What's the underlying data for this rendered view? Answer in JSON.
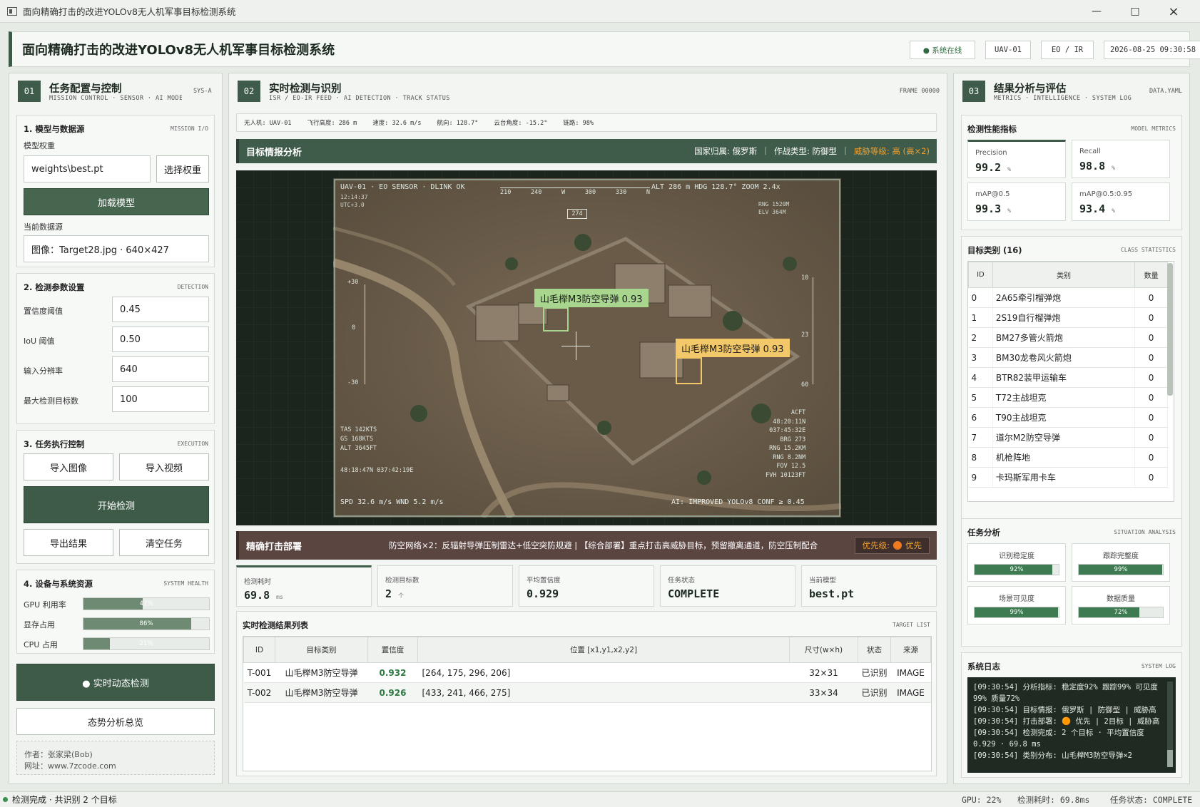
{
  "window": {
    "title": "面向精确打击的改进YOLOv8无人机军事目标检测系统",
    "minimize_icon": "minimize-icon",
    "maximize_icon": "maximize-icon",
    "close_icon": "close-icon"
  },
  "header": {
    "title": "面向精确打击的改进YOLOv8无人机军事目标检测系统",
    "chips": [
      "● 系统在线",
      "UAV-01",
      "EO / IR",
      "2026-08-25 09:30:58"
    ]
  },
  "left": {
    "num": "01",
    "title": "任务配置与控制",
    "subtitle": "MISSION CONTROL · SENSOR · AI MODEL",
    "tag": "SYS-A",
    "model": {
      "title": "1. 模型与数据源",
      "tag": "MISSION I/O",
      "weight_label": "模型权重",
      "weight_value": "weights\\best.pt",
      "choose_weight": "选择权重",
      "load_model": "加载模型",
      "source_label": "当前数据源",
      "source_value": "图像：Target28.jpg · 640×427"
    },
    "params": {
      "title": "2. 检测参数设置",
      "tag": "DETECTION",
      "items": [
        {
          "label": "置信度阈值",
          "value": "0.45"
        },
        {
          "label": "IoU 阈值",
          "value": "0.50"
        },
        {
          "label": "输入分辨率",
          "value": "640"
        },
        {
          "label": "最大检测目标数",
          "value": "100"
        }
      ]
    },
    "exec": {
      "title": "3. 任务执行控制",
      "tag": "EXECUTION",
      "import_image": "导入图像",
      "import_video": "导入视频",
      "start": "开始检测",
      "export": "导出结果",
      "clear": "清空任务"
    },
    "health": {
      "title": "4. 设备与系统资源",
      "tag": "SYSTEM HEALTH",
      "items": [
        {
          "label": "GPU 利用率",
          "value": 47,
          "text": "47%"
        },
        {
          "label": "显存占用",
          "value": 86,
          "text": "86%"
        },
        {
          "label": "CPU 占用",
          "value": 21,
          "text": "21%"
        }
      ]
    },
    "realtime_btn": "● 实时动态检测",
    "overview_btn": "态势分析总览",
    "author": "作者：张家梁(Bob)",
    "site": "网址：www.7zcode.com"
  },
  "center": {
    "num": "02",
    "title": "实时检测与识别",
    "subtitle": "ISR / EO-IR FEED · AI DETECTION · TRACK STATUS",
    "tag": "FRAME 00000",
    "telemetry": [
      "无人机: UAV-01",
      "飞行高度: 286 m",
      "速度: 32.6 m/s",
      "航向: 128.7°",
      "云台角度: -15.2°",
      "链路: 98%"
    ],
    "intel": {
      "title": "目标情报分析",
      "country": "国家归属: 俄罗斯",
      "type": "作战类型: 防御型",
      "threat": "威胁等级: 高 (高×2)"
    },
    "hud": {
      "top_left": "UAV-01 · EO SENSOR · DLINK OK",
      "top_right": "ALT 286 m   HDG 128.7°   ZOOM 2.4x",
      "time": "12:14:37",
      "utc": "UTC+3.0",
      "heading_box": "274",
      "compass": [
        "210",
        "240",
        "W",
        "300",
        "330",
        "N"
      ],
      "rng_elv": [
        "RNG  1520M",
        "ELV   364M"
      ],
      "left_scale": [
        "+30",
        "0",
        "-30"
      ],
      "right_scale": [
        "10",
        "23",
        "60"
      ],
      "left_block": [
        "TAS  142KTS",
        "GS   168KTS",
        "ALT   3645FT"
      ],
      "coords": "48:18:47N  037:42:19E",
      "right_block": [
        "ACFT",
        "48:20:11N",
        "037:45:32E",
        "BRG     273",
        "RNG  15.2KM",
        "RNG   8.2NM",
        "FOV    12.5",
        "FVH  10123FT"
      ],
      "bottom_left": "SPD 32.6 m/s   WND 5.2 m/s",
      "bottom_right": "AI: IMPROVED YOLOv8   CONF ≥ 0.45"
    },
    "detections": [
      {
        "label": "山毛榉M3防空导弹  0.93"
      },
      {
        "label": "山毛榉M3防空导弹  0.93"
      }
    ],
    "strike": {
      "title": "精确打击部署",
      "text": "防空网络×2：反辐射导弹压制雷达+低空突防规避 | 【综合部署】重点打击高威胁目标，预留撤离通道，防空压制配合",
      "priority_label": "优先级:",
      "priority_value": "优先"
    },
    "stats": [
      {
        "label": "检测耗时",
        "value": "69.8",
        "unit": "ms"
      },
      {
        "label": "检测目标数",
        "value": "2",
        "unit": "个"
      },
      {
        "label": "平均置信度",
        "value": "0.929",
        "unit": ""
      },
      {
        "label": "任务状态",
        "value": "COMPLETE",
        "unit": ""
      },
      {
        "label": "当前模型",
        "value": "best.pt",
        "unit": ""
      }
    ],
    "results": {
      "title": "实时检测结果列表",
      "tag": "TARGET LIST",
      "headers": [
        "ID",
        "目标类别",
        "置信度",
        "位置 [x1,y1,x2,y2]",
        "尺寸(w×h)",
        "状态",
        "来源"
      ],
      "rows": [
        [
          "T-001",
          "山毛榉M3防空导弹",
          "0.932",
          "[264, 175, 296, 206]",
          "32×31",
          "已识别",
          "IMAGE"
        ],
        [
          "T-002",
          "山毛榉M3防空导弹",
          "0.926",
          "[433, 241, 466, 275]",
          "33×34",
          "已识别",
          "IMAGE"
        ]
      ]
    }
  },
  "right": {
    "num": "03",
    "title": "结果分析与评估",
    "subtitle": "METRICS · INTELLIGENCE · SYSTEM LOG",
    "tag": "DATA.YAML",
    "metrics": {
      "title": "检测性能指标",
      "tag": "MODEL METRICS",
      "items": [
        {
          "label": "Precision",
          "value": "99.2",
          "unit": "%"
        },
        {
          "label": "Recall",
          "value": "98.8",
          "unit": "%"
        },
        {
          "label": "mAP@0.5",
          "value": "99.3",
          "unit": "%"
        },
        {
          "label": "mAP@0.5:0.95",
          "value": "93.4",
          "unit": "%"
        }
      ]
    },
    "classes": {
      "title": "目标类别 (16)",
      "tag": "CLASS STATISTICS",
      "headers": [
        "ID",
        "类别",
        "数量"
      ],
      "rows": [
        [
          "0",
          "2A65牵引榴弹炮",
          "0"
        ],
        [
          "1",
          "2S19自行榴弹炮",
          "0"
        ],
        [
          "2",
          "BM27多管火箭炮",
          "0"
        ],
        [
          "3",
          "BM30龙卷风火箭炮",
          "0"
        ],
        [
          "4",
          "BTR82装甲运输车",
          "0"
        ],
        [
          "5",
          "T72主战坦克",
          "0"
        ],
        [
          "6",
          "T90主战坦克",
          "0"
        ],
        [
          "7",
          "道尔M2防空导弹",
          "0"
        ],
        [
          "8",
          "机枪阵地",
          "0"
        ],
        [
          "9",
          "卡玛斯军用卡车",
          "0"
        ]
      ]
    },
    "analysis": {
      "title": "任务分析",
      "tag": "SITUATION ANALYSIS",
      "items": [
        {
          "label": "识别稳定度",
          "value": 92,
          "text": "92%"
        },
        {
          "label": "跟踪完整度",
          "value": 99,
          "text": "99%"
        },
        {
          "label": "场景可见度",
          "value": 99,
          "text": "99%"
        },
        {
          "label": "数据质量",
          "value": 72,
          "text": "72%"
        }
      ]
    },
    "log": {
      "title": "系统日志",
      "tag": "SYSTEM LOG",
      "lines": [
        "[09:30:54]  分析指标: 稳定度92% 跟踪99% 可见度99% 质量72%",
        "[09:30:54]  目标情报: 俄罗斯 | 防御型 | 威胁高",
        "[09:30:54]  打击部署: 🟠 优先 | 2目标 | 威胁高",
        "[09:30:54]  检测完成: 2 个目标 · 平均置信度 0.929 · 69.8 ms",
        "[09:30:54]  类别分布: 山毛榉M3防空导弹×2"
      ]
    }
  },
  "statusbar": {
    "left": "检测完成 · 共识别 2 个目标",
    "gpu": "GPU: 22%",
    "time": "检测耗时: 69.8ms",
    "task": "任务状态: COMPLETE"
  },
  "colors": {
    "accent": "#3e5b48",
    "threat": "#f0a030",
    "box_green": "#a8d68f",
    "box_yellow": "#f2c86a",
    "strike_bar": "#5b4541"
  }
}
